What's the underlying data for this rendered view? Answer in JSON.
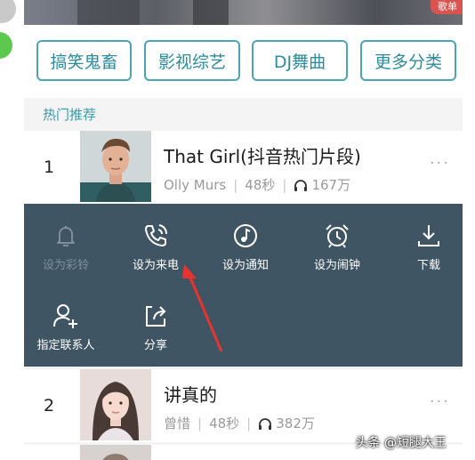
{
  "banner": {
    "tag": "歌单"
  },
  "categories": [
    "搞笑鬼畜",
    "影视综艺",
    "DJ舞曲",
    "更多分类"
  ],
  "section_title": "热门推荐",
  "songs": [
    {
      "rank": "1",
      "title": "That Girl(抖音热门片段)",
      "artist": "Olly Murs",
      "duration": "48秒",
      "plays": "167万"
    },
    {
      "rank": "2",
      "title": "讲真的",
      "artist": "曾惜",
      "duration": "48秒",
      "plays": "382万"
    }
  ],
  "actions": [
    {
      "label": "设为彩铃",
      "icon": "bell-icon",
      "enabled": false
    },
    {
      "label": "设为来电",
      "icon": "phone-ring-icon",
      "enabled": true
    },
    {
      "label": "设为通知",
      "icon": "music-note-icon",
      "enabled": true
    },
    {
      "label": "设为闹钟",
      "icon": "alarm-clock-icon",
      "enabled": true
    },
    {
      "label": "下载",
      "icon": "download-icon",
      "enabled": true
    },
    {
      "label": "指定联系人",
      "icon": "add-contact-icon",
      "enabled": true
    },
    {
      "label": "分享",
      "icon": "share-icon",
      "enabled": true
    }
  ],
  "colors": {
    "panel": "#3f5564",
    "accent": "#2e8c9c",
    "annotation_arrow": "#e8332e"
  },
  "watermark": "头条 @短腿大王"
}
